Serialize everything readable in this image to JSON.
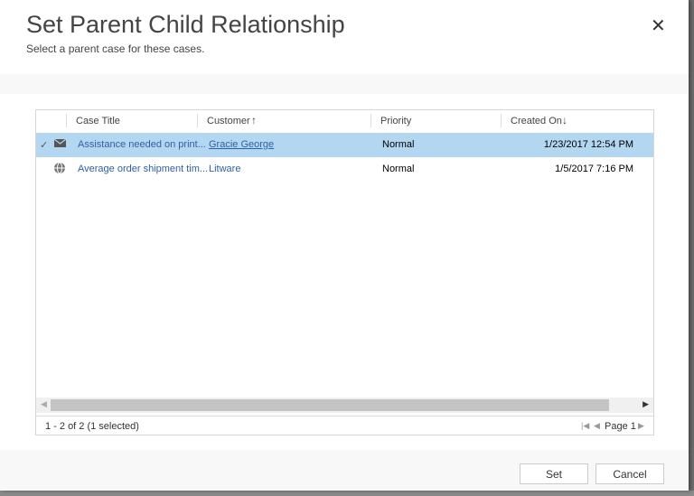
{
  "dialog": {
    "title": "Set Parent Child Relationship",
    "subtitle": "Select a parent case for these cases.",
    "close": "✕"
  },
  "grid": {
    "columns": [
      {
        "label": "Case Title"
      },
      {
        "label": "Customer",
        "sort": "↑"
      },
      {
        "label": "Priority"
      },
      {
        "label": "Created On",
        "sort": "↓"
      }
    ],
    "rows": [
      {
        "selected": true,
        "icon": "email-icon",
        "title": "Assistance needed on print...",
        "customer": "Gracie George",
        "priority": "Normal",
        "created": "1/23/2017 12:54 PM"
      },
      {
        "selected": false,
        "icon": "globe-icon",
        "title": "Average order shipment tim...",
        "customer": "Litware",
        "priority": "Normal",
        "created": "1/5/2017 7:16 PM"
      }
    ],
    "status": "1 - 2 of 2 (1 selected)",
    "page": "Page 1"
  },
  "buttons": {
    "set": "Set",
    "cancel": "Cancel"
  },
  "colors": {
    "selected_row": "#b3d7f0",
    "link": "#2f5fa8"
  }
}
